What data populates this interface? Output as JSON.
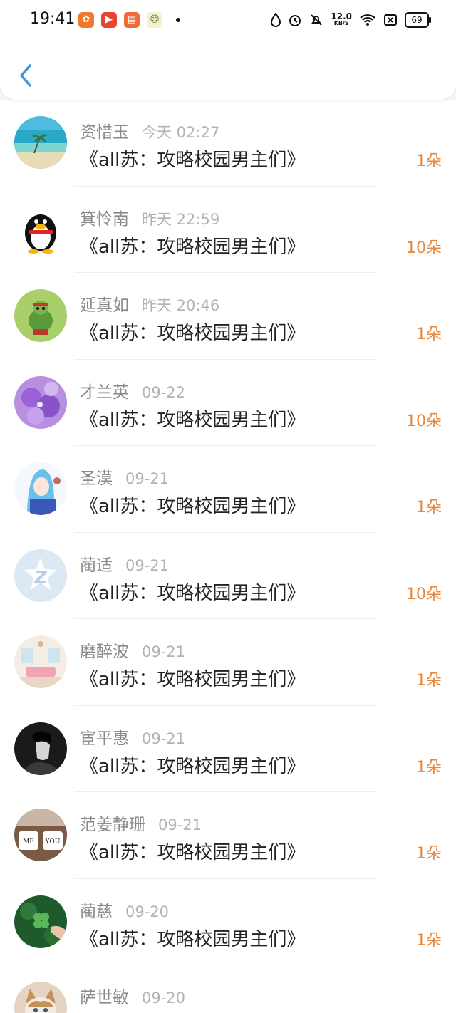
{
  "status": {
    "time": "19:41",
    "net_speed": "12.0",
    "net_unit": "KB/S",
    "battery": "69"
  },
  "records": [
    {
      "name": "资惜玉",
      "date": "今天 02:27",
      "book": "《all苏：攻略校园男主们》",
      "flowers": "1朵"
    },
    {
      "name": "箕怜南",
      "date": "昨天 22:59",
      "book": "《all苏：攻略校园男主们》",
      "flowers": "10朵"
    },
    {
      "name": "延真如",
      "date": "昨天 20:46",
      "book": "《all苏：攻略校园男主们》",
      "flowers": "1朵"
    },
    {
      "name": "才兰英",
      "date": "09-22",
      "book": "《all苏：攻略校园男主们》",
      "flowers": "10朵"
    },
    {
      "name": "圣漠",
      "date": "09-21",
      "book": "《all苏：攻略校园男主们》",
      "flowers": "1朵"
    },
    {
      "name": "蔺适",
      "date": "09-21",
      "book": "《all苏：攻略校园男主们》",
      "flowers": "10朵"
    },
    {
      "name": "磨醉波",
      "date": "09-21",
      "book": "《all苏：攻略校园男主们》",
      "flowers": "1朵"
    },
    {
      "name": "宦平惠",
      "date": "09-21",
      "book": "《all苏：攻略校园男主们》",
      "flowers": "1朵"
    },
    {
      "name": "范姜静珊",
      "date": "09-21",
      "book": "《all苏：攻略校园男主们》",
      "flowers": "1朵"
    },
    {
      "name": "蔺慈",
      "date": "09-20",
      "book": "《all苏：攻略校园男主们》",
      "flowers": "1朵"
    },
    {
      "name": "萨世敏",
      "date": "09-20",
      "book": "",
      "flowers": ""
    }
  ],
  "avatars": [
    "beach-avatar",
    "penguin-avatar",
    "turtle-avatar",
    "flower-avatar",
    "anime-girl-avatar",
    "default-z-avatar",
    "room-avatar",
    "man-portrait-avatar",
    "cups-avatar",
    "clover-avatar",
    "cat-avatar"
  ],
  "avatar_cups_text": {
    "left": "ME",
    "right": "YOU"
  },
  "colors": {
    "accent_blue": "#3a9bdc",
    "flower_orange": "#e8883f"
  }
}
